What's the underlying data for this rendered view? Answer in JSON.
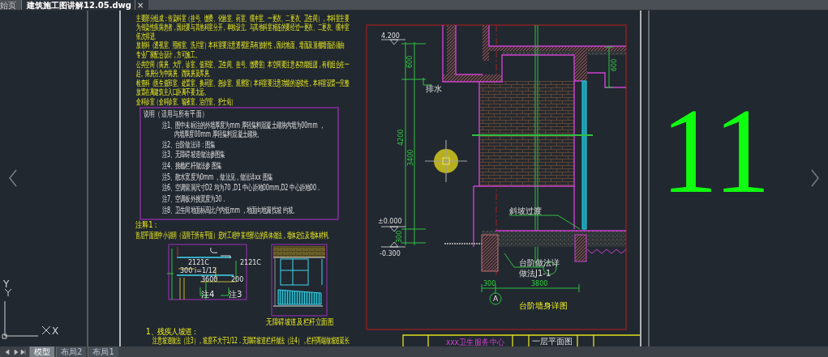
{
  "file_tabs": [
    {
      "label": "始页",
      "selected": false
    },
    {
      "label": "建筑施工图讲解12.05.dwg",
      "selected": true
    }
  ],
  "close_label": "×",
  "design_notes": [
    "主要部分组成：传染科室（挂号、缴费、化验室、药室、缓冲室、一更衣、二更衣、卫生间），本科室主要",
    "为传染性疾病患者，因此要与其他科室分开，单独设立。与其他科室相连的要经过一更衣、二更衣、缓冲室",
    "依次排进。",
    "放射科（透视室、照相室、洗片室）本科室要注意透视室具有放射性，因此地面、墙面及顶棚墙面必须由",
    "专业厂家配合设计，方可施工。",
    "公共空间（病房、大厅、诊室、值班室、卫生间、挂号、缴费室）本空间要注意各功能组团，有机组合在一",
    "起。病房分为中病房、西病房及库房。",
    "检查科（医生值班室、处置室、换药室、急诊室、观察室）本科室要注意功能的连续性，本科室设置一完整",
    "放置在离建筑主入口距离不要太远。",
    "全科诊室（全科诊室、输液室、治疗室、护士站）"
  ],
  "notes_box": {
    "title": "说明（适用与所有平面）",
    "items": [
      "注1、图中未标注的外墙厚度为mm   厚轻集料混凝土砌块内墙为00mm ，",
      "内墙厚度00mm   厚轻集料混凝土砌块。",
      "注2、台阶做法详：图集",
      "注3、无障碍坡道做法参图集",
      "注4、挑檐栏杆做法参 图集",
      "注5、散水宽度为0mm ，做法见，做法详xx 图集",
      "注6、空调留洞尺寸D2 均为70 ,D1 中心距地00mm,D2  中心距地00 .",
      "注7、空调板外挑宽度为30 .",
      "注8、卫生间地面标高比户内低mm ，地面向地漏找坡 约坡。"
    ]
  },
  "annotation": {
    "title": "注释1：",
    "text": "首层平面图中小说明（适用于所有平面）是对工程中某些部位的具体做法，墙体定位及墙体材料。"
  },
  "ramp_plan_labels": [
    "2121C",
    "i=1/12",
    "2121C",
    "300",
    "3600",
    "200",
    "注4",
    "注3"
  ],
  "ramp_elevation_caption": "无障碍坡道及栏杆立面图",
  "ramp_notes": {
    "heading": "1、残疾人坡道：",
    "text": "注意坡道做法（注3），坡度不大于1/12．无障碍坡道栏杆做法（注4），栏杆两端做坡道延长"
  },
  "section_labels": [
    "4.200",
    "600",
    "4200",
    "3400",
    "排水",
    "斜坡过渡",
    "±0.000",
    "300",
    "-0.300",
    "600",
    "台阶做法详",
    "做法J1-1",
    "300",
    "3800"
  ],
  "axis_bubble": "A",
  "section_title": "台阶墙身详图",
  "title_block": [
    "xxx卫生服务中心",
    "一层平面图"
  ],
  "sheet_number": "11",
  "ucs": {
    "y": "Y",
    "x": "X"
  },
  "layout_tabs": [
    {
      "label": "模型",
      "selected": true
    },
    {
      "label": "布局2",
      "selected": false
    },
    {
      "label": "布局1",
      "selected": false
    }
  ]
}
